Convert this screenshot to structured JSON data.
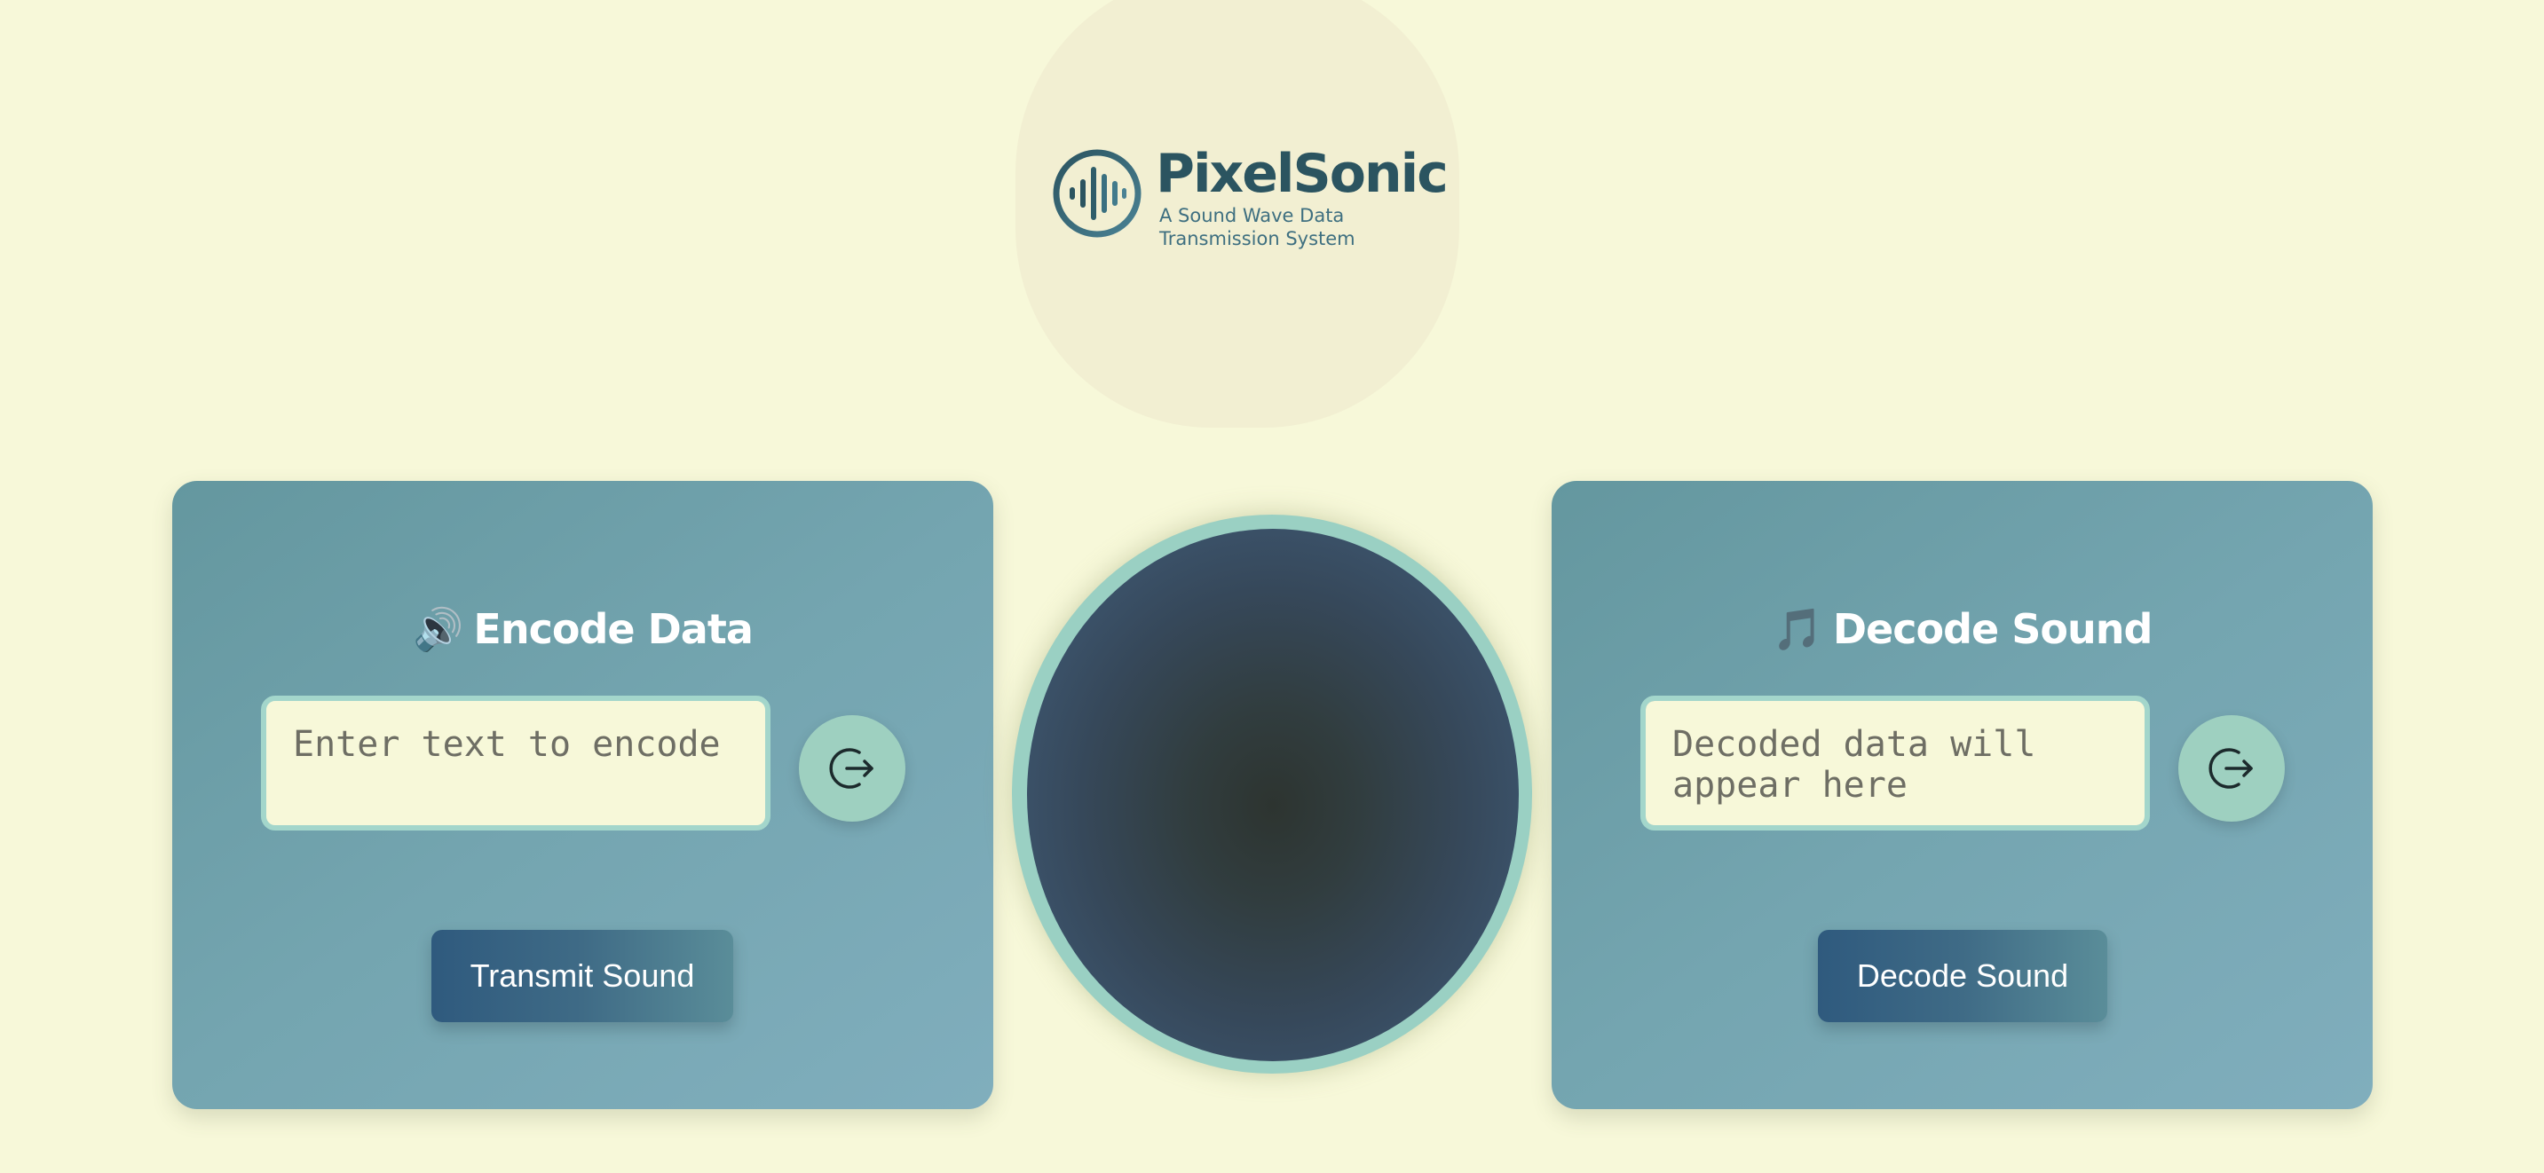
{
  "app": {
    "title": "PixelSonic",
    "subtitle": "A Sound Wave Data Transmission System"
  },
  "colors": {
    "background": "#f7f8d9",
    "panel": "#74a5b0",
    "accent": "#9ed0c0",
    "button": "#2f5a7e",
    "brand_text": "#2b5460"
  },
  "encode": {
    "icon": "speaker-icon",
    "icon_glyph": "🔊",
    "title": "Encode Data",
    "input_value": "",
    "input_placeholder": "Enter text to encode",
    "action_icon": "sign-in-arrow-icon",
    "button_label": "Transmit Sound"
  },
  "decode": {
    "icon": "music-note-icon",
    "icon_glyph": "🎵",
    "title": "Decode Sound",
    "output_value": "",
    "output_placeholder": "Decoded data will appear here",
    "action_icon": "sign-in-arrow-icon",
    "button_label": "Decode Sound"
  },
  "visualizer": {
    "icon": "sound-orb"
  }
}
